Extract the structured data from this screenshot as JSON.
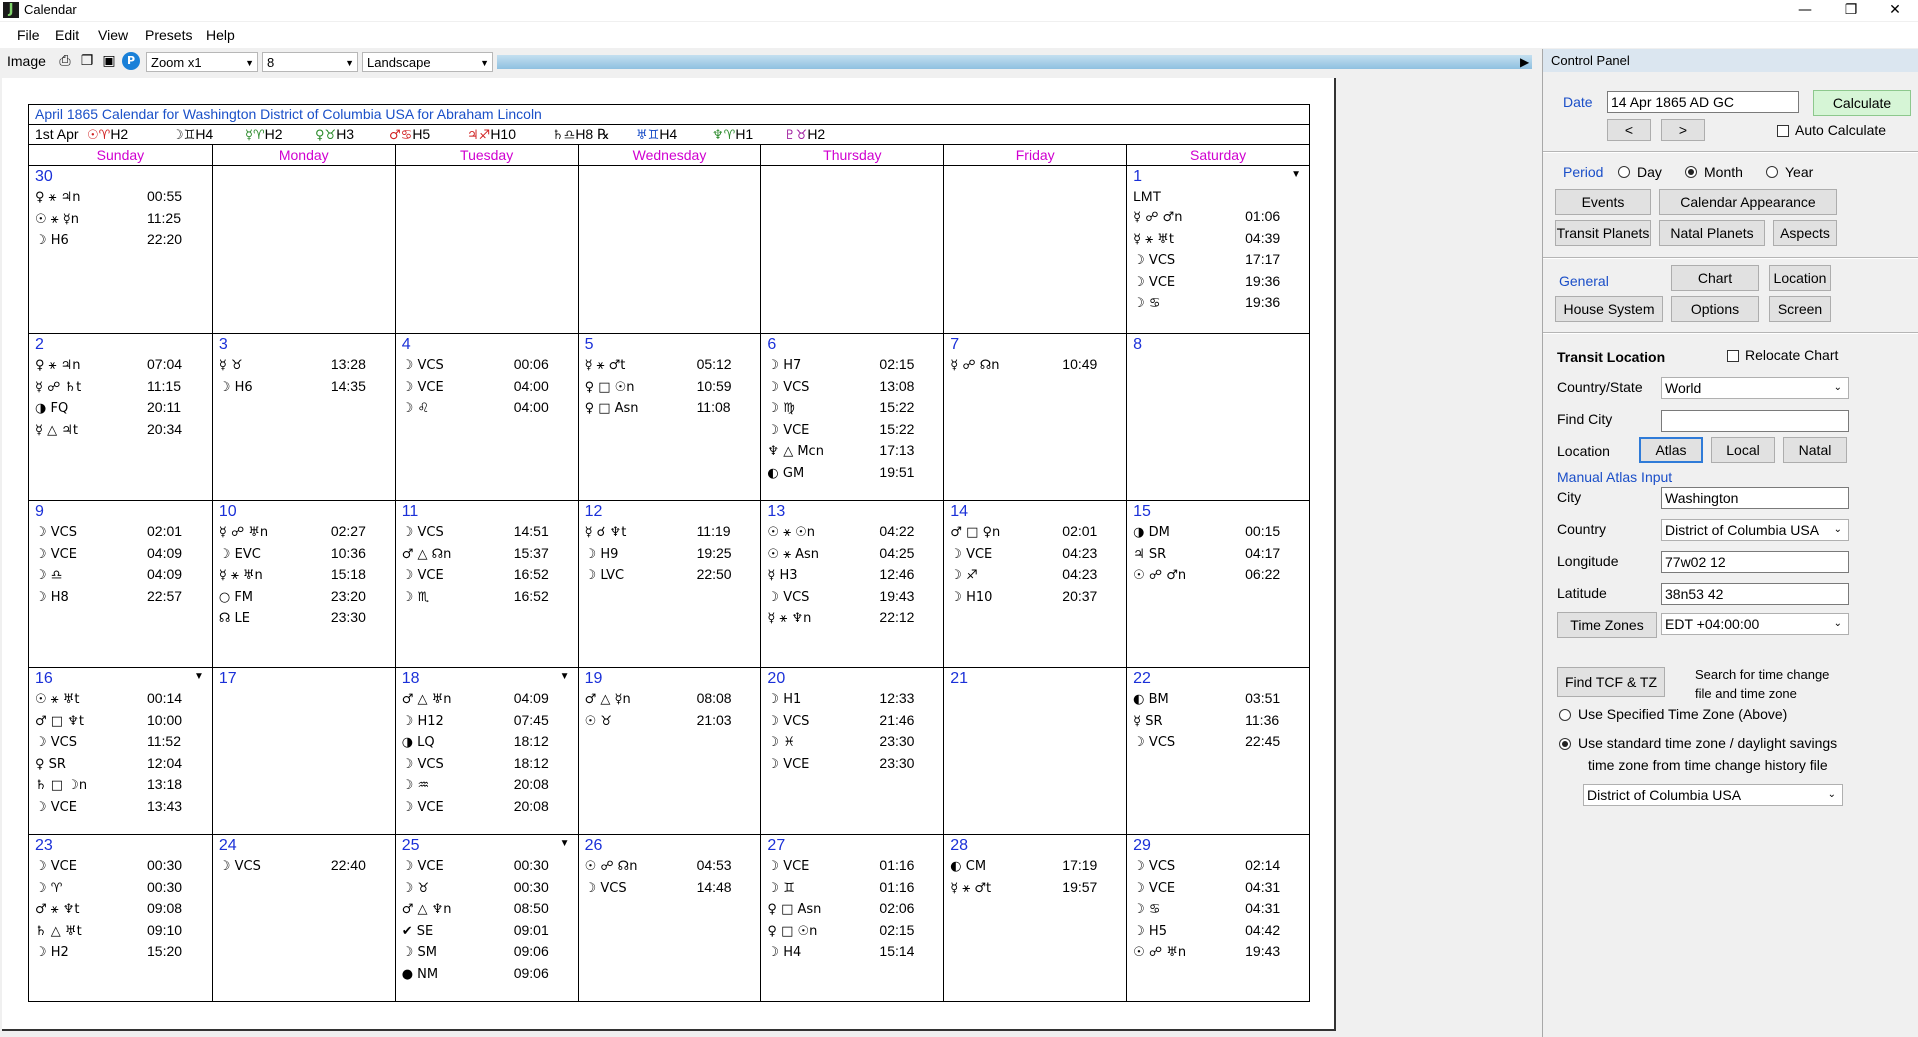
{
  "window": {
    "title": "Calendar",
    "controls": [
      "—",
      "❐",
      "✕"
    ]
  },
  "menu": [
    "File",
    "Edit",
    "View",
    "Presets",
    "Help"
  ],
  "toolbar": {
    "image_label": "Image",
    "zoom": "Zoom x1",
    "size": "8",
    "orientation": "Landscape"
  },
  "calendar": {
    "title": "April 1865 Calendar for Washington District of Columbia USA for Abraham Lincoln",
    "ingress_label": "1st Apr",
    "ingresses": [
      {
        "glyph": "☉♈",
        "house": "H2",
        "color": "#d02020"
      },
      {
        "glyph": "☽♊",
        "house": "H4",
        "color": "#202020"
      },
      {
        "glyph": "☿♈",
        "house": "H2",
        "color": "#2a8a2a"
      },
      {
        "glyph": "♀♉",
        "house": "H3",
        "color": "#2a8a2a"
      },
      {
        "glyph": "♂♋",
        "house": "H5",
        "color": "#d02020"
      },
      {
        "glyph": "♃♐",
        "house": "H10",
        "color": "#d02020"
      },
      {
        "glyph": "♄♎",
        "house": "H8 ℞",
        "color": "#202020"
      },
      {
        "glyph": "♅♊",
        "house": "H4",
        "color": "#1a4ec8"
      },
      {
        "glyph": "♆♈",
        "house": "H1",
        "color": "#2a8a2a"
      },
      {
        "glyph": "♇♉",
        "house": "H2",
        "color": "#a020a0"
      }
    ],
    "weekdays": [
      "Sunday",
      "Monday",
      "Tuesday",
      "Wednesday",
      "Thursday",
      "Friday",
      "Saturday"
    ],
    "days": [
      {
        "num": "30",
        "events": [
          [
            "♀ ⚹ ♃n",
            "00:55"
          ],
          [
            "☉ ⚹ ☿n",
            "11:25"
          ],
          [
            "☽ H6",
            "22:20"
          ]
        ]
      },
      {
        "num": "",
        "events": []
      },
      {
        "num": "",
        "events": []
      },
      {
        "num": "",
        "events": []
      },
      {
        "num": "",
        "events": []
      },
      {
        "num": "",
        "events": []
      },
      {
        "num": "1",
        "note": "LMT",
        "dropdown": true,
        "events": [
          [
            "☿ ☍ ♂n",
            "01:06"
          ],
          [
            "☿ ⚹ ♅t",
            "04:39"
          ],
          [
            "☽ VCS",
            "17:17"
          ],
          [
            "☽ VCE",
            "19:36"
          ],
          [
            "☽ ♋",
            "19:36"
          ]
        ]
      },
      {
        "num": "2",
        "events": [
          [
            "♀ ⚹ ♃n",
            "07:04"
          ],
          [
            "☿ ☍ ♄t",
            "11:15"
          ],
          [
            "◑ FQ",
            "20:11"
          ],
          [
            "☿ △ ♃t",
            "20:34"
          ]
        ]
      },
      {
        "num": "3",
        "events": [
          [
            "☿ ♉",
            "13:28"
          ],
          [
            "☽ H6",
            "14:35"
          ]
        ]
      },
      {
        "num": "4",
        "events": [
          [
            "☽ VCS",
            "00:06"
          ],
          [
            "☽ VCE",
            "04:00"
          ],
          [
            "☽ ♌",
            "04:00"
          ]
        ]
      },
      {
        "num": "5",
        "events": [
          [
            "☿ ⚹ ♂t",
            "05:12"
          ],
          [
            "♀ □ ☉n",
            "10:59"
          ],
          [
            "♀ □ Asn",
            "11:08"
          ]
        ]
      },
      {
        "num": "6",
        "events": [
          [
            "☽ H7",
            "02:15"
          ],
          [
            "☽ VCS",
            "13:08"
          ],
          [
            "☽ ♍",
            "15:22"
          ],
          [
            "☽ VCE",
            "15:22"
          ],
          [
            "♆ △ Mcn",
            "17:13"
          ],
          [
            "◐ GM",
            "19:51"
          ]
        ]
      },
      {
        "num": "7",
        "events": [
          [
            "☿ ☍ ☊n",
            "10:49"
          ]
        ]
      },
      {
        "num": "8",
        "events": []
      },
      {
        "num": "9",
        "events": [
          [
            "☽ VCS",
            "02:01"
          ],
          [
            "☽ VCE",
            "04:09"
          ],
          [
            "☽ ♎",
            "04:09"
          ],
          [
            "☽ H8",
            "22:57"
          ]
        ]
      },
      {
        "num": "10",
        "events": [
          [
            "☿ ☍ ♅n",
            "02:27"
          ],
          [
            "☽ EVC",
            "10:36"
          ],
          [
            "☿ ⚹ ♅n",
            "15:18"
          ],
          [
            "○ FM",
            "23:20"
          ],
          [
            "☊ LE",
            "23:30"
          ]
        ]
      },
      {
        "num": "11",
        "events": [
          [
            "☽ VCS",
            "14:51"
          ],
          [
            "♂ △ ☊n",
            "15:37"
          ],
          [
            "☽ VCE",
            "16:52"
          ],
          [
            "☽ ♏",
            "16:52"
          ]
        ]
      },
      {
        "num": "12",
        "events": [
          [
            "☿ ☌ ♆t",
            "11:19"
          ],
          [
            "☽ H9",
            "19:25"
          ],
          [
            "☽ LVC",
            "22:50"
          ]
        ]
      },
      {
        "num": "13",
        "events": [
          [
            "☉ ⚹ ☉n",
            "04:22"
          ],
          [
            "☉ ⚹ Asn",
            "04:25"
          ],
          [
            "☿ H3",
            "12:46"
          ],
          [
            "☽ VCS",
            "19:43"
          ],
          [
            "☿ ⚹ ♆n",
            "22:12"
          ]
        ]
      },
      {
        "num": "14",
        "events": [
          [
            "♂ □ ♀n",
            "02:01"
          ],
          [
            "☽ VCE",
            "04:23"
          ],
          [
            "☽ ♐",
            "04:23"
          ],
          [
            "☽ H10",
            "20:37"
          ]
        ]
      },
      {
        "num": "15",
        "events": [
          [
            "◑ DM",
            "00:15"
          ],
          [
            "♃ SR",
            "04:17"
          ],
          [
            "☉ ☍ ♂n",
            "06:22"
          ]
        ]
      },
      {
        "num": "16",
        "dropdown": true,
        "events": [
          [
            "☉ ⚹ ♅t",
            "00:14"
          ],
          [
            "♂ □ ♆t",
            "10:00"
          ],
          [
            "☽ VCS",
            "11:52"
          ],
          [
            "♀ SR",
            "12:04"
          ],
          [
            "♄ □ ☽n",
            "13:18"
          ],
          [
            "☽ VCE",
            "13:43"
          ]
        ]
      },
      {
        "num": "17",
        "events": []
      },
      {
        "num": "18",
        "dropdown": true,
        "events": [
          [
            "♂ △ ♅n",
            "04:09"
          ],
          [
            "☽ H12",
            "07:45"
          ],
          [
            "◑ LQ",
            "18:12"
          ],
          [
            "☽ VCS",
            "18:12"
          ],
          [
            "☽ ♒",
            "20:08"
          ],
          [
            "☽ VCE",
            "20:08"
          ]
        ]
      },
      {
        "num": "19",
        "events": [
          [
            "♂ △ ☿n",
            "08:08"
          ],
          [
            "☉ ♉",
            "21:03"
          ]
        ]
      },
      {
        "num": "20",
        "events": [
          [
            "☽ H1",
            "12:33"
          ],
          [
            "☽ VCS",
            "21:46"
          ],
          [
            "☽ ♓",
            "23:30"
          ],
          [
            "☽ VCE",
            "23:30"
          ]
        ]
      },
      {
        "num": "21",
        "events": []
      },
      {
        "num": "22",
        "events": [
          [
            "◐ BM",
            "03:51"
          ],
          [
            "☿ SR",
            "11:36"
          ],
          [
            "☽ VCS",
            "22:45"
          ]
        ]
      },
      {
        "num": "23",
        "events": [
          [
            "☽ VCE",
            "00:30"
          ],
          [
            "☽ ♈",
            "00:30"
          ],
          [
            "♂ ⚹ ♆t",
            "09:08"
          ],
          [
            "♄ △ ♅t",
            "09:10"
          ],
          [
            "☽ H2",
            "15:20"
          ]
        ]
      },
      {
        "num": "24",
        "events": [
          [
            "☽ VCS",
            "22:40"
          ]
        ]
      },
      {
        "num": "25",
        "dropdown": true,
        "events": [
          [
            "☽ VCE",
            "00:30"
          ],
          [
            "☽ ♉",
            "00:30"
          ],
          [
            "♂ △ ♆n",
            "08:50"
          ],
          [
            "✔ SE",
            "09:01"
          ],
          [
            "☽ SM",
            "09:06"
          ],
          [
            "● NM",
            "09:06"
          ]
        ]
      },
      {
        "num": "26",
        "events": [
          [
            "☉ ☍ ☊n",
            "04:53"
          ],
          [
            "☽ VCS",
            "14:48"
          ]
        ]
      },
      {
        "num": "27",
        "events": [
          [
            "☽ VCE",
            "01:16"
          ],
          [
            "☽ ♊",
            "01:16"
          ],
          [
            "♀ □ Asn",
            "02:06"
          ],
          [
            "♀ □ ☉n",
            "02:15"
          ],
          [
            "☽ H4",
            "15:14"
          ]
        ]
      },
      {
        "num": "28",
        "events": [
          [
            "◐ CM",
            "17:19"
          ],
          [
            "☿ ⚹ ♂t",
            "19:57"
          ]
        ]
      },
      {
        "num": "29",
        "events": [
          [
            "☽ VCS",
            "02:14"
          ],
          [
            "☽ VCE",
            "04:31"
          ],
          [
            "☽ ♋",
            "04:31"
          ],
          [
            "☽ H5",
            "04:42"
          ],
          [
            "☉ ☍ ♅n",
            "19:43"
          ]
        ]
      }
    ]
  },
  "control_panel": {
    "title": "Control Panel",
    "date_label": "Date",
    "date_value": "14 Apr 1865 AD GC",
    "calculate": "Calculate",
    "prev": "<",
    "next": ">",
    "auto_calculate": "Auto Calculate",
    "period_label": "Period",
    "period_options": [
      "Day",
      "Month",
      "Year"
    ],
    "period_selected": "Month",
    "buttons_row1": [
      "Events",
      "Calendar Appearance"
    ],
    "buttons_row2": [
      "Transit Planets",
      "Natal Planets",
      "Aspects"
    ],
    "general_label": "General",
    "chart": "Chart",
    "location": "Location",
    "house_system": "House System",
    "options": "Options",
    "screen": "Screen",
    "transit_location": "Transit Location",
    "relocate_chart": "Relocate Chart",
    "country_state_label": "Country/State",
    "country_state_value": "World",
    "find_city_label": "Find City",
    "find_city_value": "",
    "location_label": "Location",
    "atlas": "Atlas",
    "local": "Local",
    "natal": "Natal",
    "manual_atlas": "Manual Atlas Input",
    "city_label": "City",
    "city_value": "Washington",
    "country_label": "Country",
    "country_value": "District of Columbia USA",
    "longitude_label": "Longitude",
    "longitude_value": "77w02 12",
    "latitude_label": "Latitude",
    "latitude_value": "38n53 42",
    "time_zones": "Time Zones",
    "time_zone_value": "EDT +04:00:00",
    "find_tcf": "Find TCF & TZ",
    "search_text_1": "Search for time change",
    "search_text_2": "file and time zone",
    "use_specified": "Use Specified Time Zone (Above)",
    "use_standard_1": "Use standard time zone / daylight savings",
    "use_standard_2": "time zone from time change history file",
    "history_value": "District of Columbia USA"
  }
}
